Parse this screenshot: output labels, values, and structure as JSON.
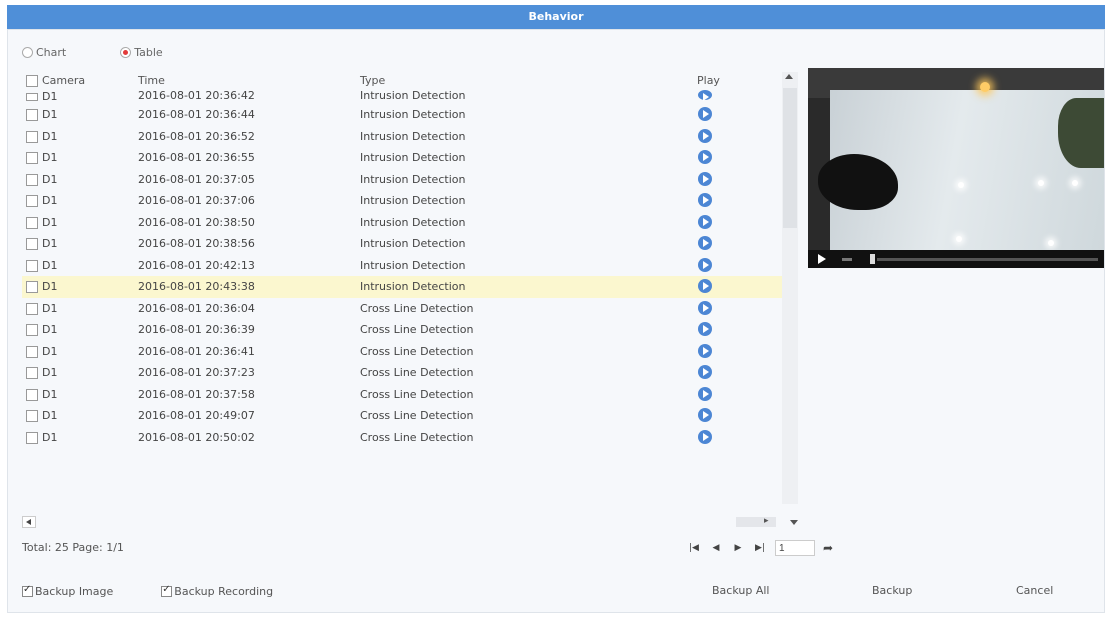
{
  "window": {
    "title": "Behavior"
  },
  "view_mode": {
    "options": [
      "Chart",
      "Table"
    ],
    "selected": "Table"
  },
  "table": {
    "headers": {
      "camera": "Camera",
      "time": "Time",
      "type": "Type",
      "play": "Play"
    },
    "first_partial_row": {
      "camera": "D1",
      "time": "2016-08-01 20:36:42",
      "type": "Intrusion Detection"
    },
    "rows": [
      {
        "camera": "D1",
        "time": "2016-08-01 20:36:44",
        "type": "Intrusion Detection"
      },
      {
        "camera": "D1",
        "time": "2016-08-01 20:36:52",
        "type": "Intrusion Detection"
      },
      {
        "camera": "D1",
        "time": "2016-08-01 20:36:55",
        "type": "Intrusion Detection"
      },
      {
        "camera": "D1",
        "time": "2016-08-01 20:37:05",
        "type": "Intrusion Detection"
      },
      {
        "camera": "D1",
        "time": "2016-08-01 20:37:06",
        "type": "Intrusion Detection"
      },
      {
        "camera": "D1",
        "time": "2016-08-01 20:38:50",
        "type": "Intrusion Detection"
      },
      {
        "camera": "D1",
        "time": "2016-08-01 20:38:56",
        "type": "Intrusion Detection"
      },
      {
        "camera": "D1",
        "time": "2016-08-01 20:42:13",
        "type": "Intrusion Detection"
      },
      {
        "camera": "D1",
        "time": "2016-08-01 20:43:38",
        "type": "Intrusion Detection",
        "highlighted": true
      },
      {
        "camera": "D1",
        "time": "2016-08-01 20:36:04",
        "type": "Cross Line Detection"
      },
      {
        "camera": "D1",
        "time": "2016-08-01 20:36:39",
        "type": "Cross Line Detection"
      },
      {
        "camera": "D1",
        "time": "2016-08-01 20:36:41",
        "type": "Cross Line Detection"
      },
      {
        "camera": "D1",
        "time": "2016-08-01 20:37:23",
        "type": "Cross Line Detection"
      },
      {
        "camera": "D1",
        "time": "2016-08-01 20:37:58",
        "type": "Cross Line Detection"
      },
      {
        "camera": "D1",
        "time": "2016-08-01 20:49:07",
        "type": "Cross Line Detection"
      },
      {
        "camera": "D1",
        "time": "2016-08-01 20:50:02",
        "type": "Cross Line Detection"
      }
    ]
  },
  "summary": {
    "text": "Total: 25  Page: 1/1"
  },
  "pager": {
    "page_value": "1"
  },
  "options": {
    "backup_image": "Backup Image",
    "backup_recording": "Backup Recording"
  },
  "buttons": {
    "backup_all": "Backup All",
    "backup": "Backup",
    "cancel": "Cancel"
  },
  "colors": {
    "title_bar": "#4f8fd8",
    "highlight_row": "#fbf7cf",
    "play_icon": "#4c86d4",
    "radio_selected": "#e23a3a"
  }
}
